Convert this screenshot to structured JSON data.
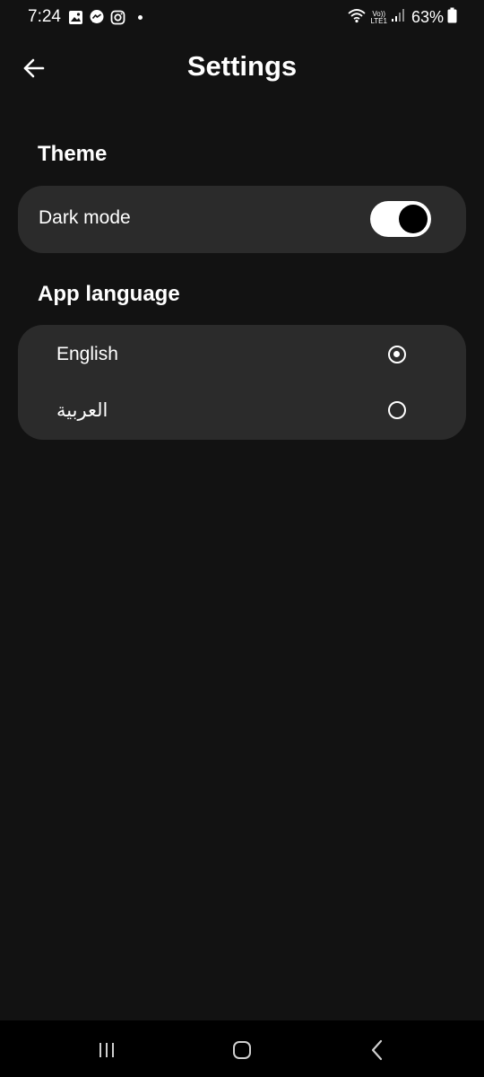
{
  "status_bar": {
    "time": "7:24",
    "volte_top": "Vo))",
    "volte_bottom": "LTE1",
    "battery_percent": "63%",
    "icons": [
      "gallery-icon",
      "messenger-icon",
      "instagram-icon",
      "wifi-icon",
      "signal-icon",
      "battery-icon"
    ]
  },
  "header": {
    "title": "Settings",
    "back_icon": "arrow-left-icon"
  },
  "theme_section": {
    "title": "Theme",
    "dark_mode_label": "Dark mode",
    "dark_mode_enabled": true
  },
  "language_section": {
    "title": "App language",
    "options": [
      {
        "label": "English",
        "selected": true
      },
      {
        "label": "العربية",
        "selected": false
      }
    ]
  },
  "nav_bar": {
    "buttons": [
      "recent-apps-icon",
      "home-icon",
      "back-icon"
    ]
  },
  "colors": {
    "background": "#121212",
    "card": "#2b2b2b",
    "text": "#ffffff",
    "nav_background": "#000000"
  }
}
